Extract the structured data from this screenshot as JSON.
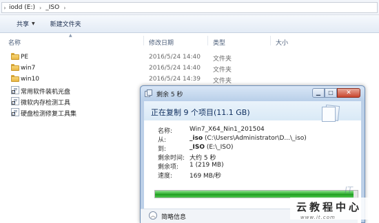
{
  "address": {
    "crumbs": [
      "iodd (E:)",
      "_ISO"
    ]
  },
  "toolbar": {
    "share_label": "共享",
    "new_folder_label": "新建文件夹"
  },
  "columns": {
    "name": "名称",
    "date": "修改日期",
    "type": "类型",
    "size": "大小"
  },
  "files": [
    {
      "name": "PE",
      "date": "2016/5/24 14:40",
      "type": "文件夹",
      "icon": "folder-icon"
    },
    {
      "name": "win7",
      "date": "2016/5/24 14:40",
      "type": "文件夹",
      "icon": "folder-icon"
    },
    {
      "name": "win10",
      "date": "2016/5/24 14:39",
      "type": "文件夹",
      "icon": "folder-icon"
    },
    {
      "name": "常用软件装机光盘",
      "date": "",
      "type": "",
      "icon": "shortcut-icon"
    },
    {
      "name": "微软内存检测工具",
      "date": "",
      "type": "",
      "icon": "shortcut-icon"
    },
    {
      "name": "硬盘检测修复工具集",
      "date": "",
      "type": "",
      "icon": "shortcut-icon"
    }
  ],
  "dialog": {
    "title": "剩余 5 秒",
    "heading": "正在复制 9 个项目(11.1 GB)",
    "rows": [
      {
        "key": "名称:",
        "value": "Win7_X64_Nin1_201504",
        "bold": ""
      },
      {
        "key": "从:",
        "value": " (C:\\Users\\Administrator\\D...\\_iso)",
        "bold": "_iso"
      },
      {
        "key": "到:",
        "value": " (E:\\_ISO)",
        "bold": "_ISO"
      },
      {
        "key": "剩余时间:",
        "value": "大约 5 秒",
        "bold": ""
      },
      {
        "key": "剩余项:",
        "value": "1 (219 MB)",
        "bold": ""
      },
      {
        "key": "速度:",
        "value": "169 MB/秒",
        "bold": ""
      }
    ],
    "progress_fraction": 0.98,
    "details_label": "简略信息"
  },
  "watermark": {
    "text": "云教程中心",
    "url": "www.it.com",
    "faint": "IT"
  }
}
